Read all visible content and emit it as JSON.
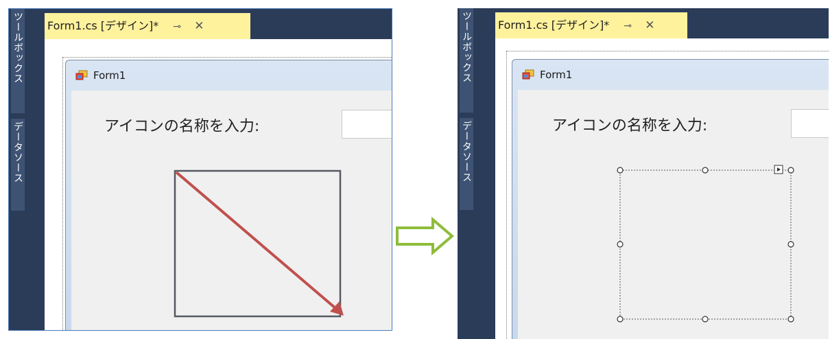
{
  "side_panel": {
    "toolbox_label": "ツールボックス",
    "datasource_label": "データソース"
  },
  "document_tab": {
    "title": "Form1.cs [デザイン]*",
    "pin_icon": "ⵝ",
    "close_icon": "✕"
  },
  "form": {
    "title": "Form1",
    "prompt_label": "アイコンの名称を入力:"
  },
  "colors": {
    "ide_dark": "#2b3c59",
    "tab_yellow": "#fff29d",
    "drag_arrow": "#c0504d",
    "transition_arrow": "#8fbc3b"
  }
}
